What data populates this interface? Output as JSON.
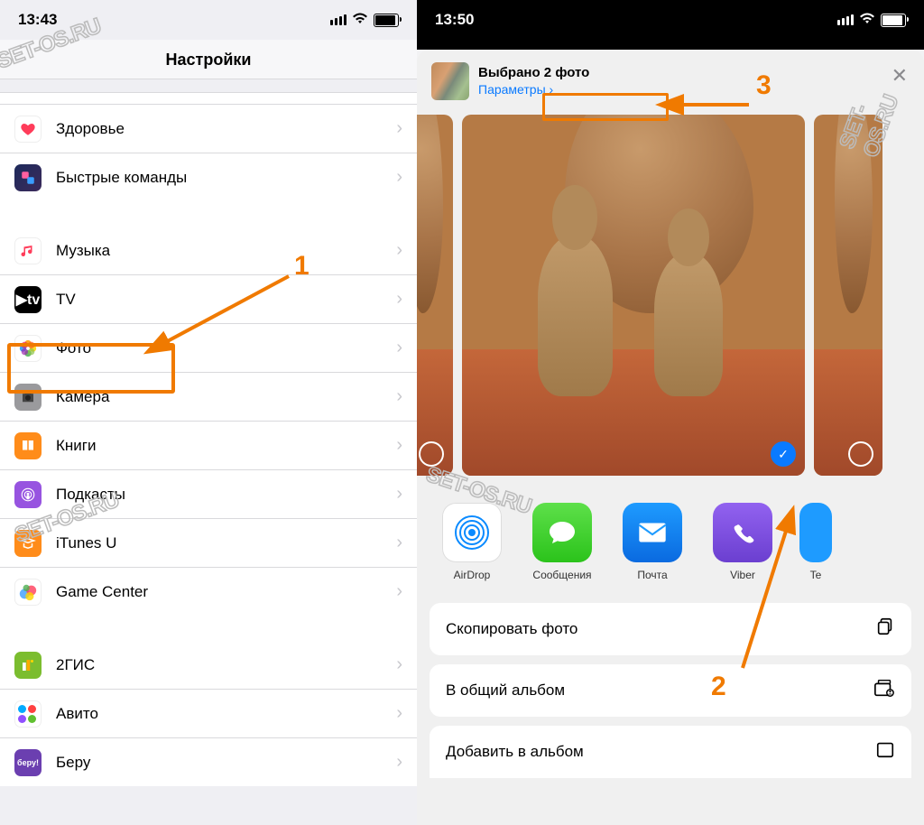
{
  "left": {
    "time": "13:43",
    "title": "Настройки",
    "group1": [
      {
        "id": "health",
        "label": "Здоровье"
      },
      {
        "id": "shortcuts",
        "label": "Быстрые команды"
      }
    ],
    "group2": [
      {
        "id": "music",
        "label": "Музыка"
      },
      {
        "id": "tv",
        "label": "TV"
      },
      {
        "id": "photos",
        "label": "Фото"
      },
      {
        "id": "camera",
        "label": "Камера"
      },
      {
        "id": "books",
        "label": "Книги"
      },
      {
        "id": "podcasts",
        "label": "Подкасты"
      },
      {
        "id": "itunesu",
        "label": "iTunes U"
      },
      {
        "id": "gamecenter",
        "label": "Game Center"
      }
    ],
    "group3": [
      {
        "id": "2gis",
        "label": "2ГИС"
      },
      {
        "id": "avito",
        "label": "Авито"
      },
      {
        "id": "beru",
        "label": "Беру"
      }
    ]
  },
  "right": {
    "time": "13:50",
    "header_title": "Выбрано 2 фото",
    "header_options": "Параметры",
    "apps": [
      {
        "id": "airdrop",
        "label": "AirDrop"
      },
      {
        "id": "messages",
        "label": "Сообщения"
      },
      {
        "id": "mail",
        "label": "Почта"
      },
      {
        "id": "viber",
        "label": "Viber"
      },
      {
        "id": "extra",
        "label": "Te"
      }
    ],
    "actions": [
      {
        "id": "copy",
        "label": "Скопировать фото"
      },
      {
        "id": "shared",
        "label": "В общий альбом"
      },
      {
        "id": "add",
        "label": "Добавить в альбом"
      }
    ]
  },
  "annotations": {
    "one": "1",
    "two": "2",
    "three": "3"
  },
  "watermark": "SET-OS.RU"
}
